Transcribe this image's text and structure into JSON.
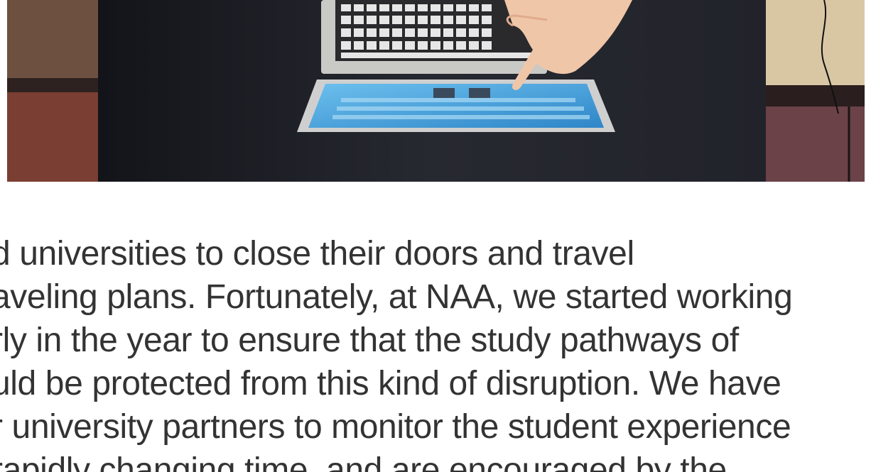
{
  "hero_image": {
    "icon": "photo-laptop-tablet-hand"
  },
  "article": {
    "lines": [
      "d universities to close their doors and travel",
      "aveling plans. Fortunately, at NAA, we started working",
      "rly in the year to ensure that the study pathways of",
      "uld be protected from this kind of disruption. We have",
      "r university partners to monitor the student experience",
      "rapidly changing time, and are encouraged by the"
    ]
  },
  "colors": {
    "text": "#333333",
    "background": "#ffffff",
    "desk": "#1c1e26",
    "carpet": "#6a4a3c",
    "floor": "#d8c8a8",
    "screen": "#4fa8e0"
  }
}
